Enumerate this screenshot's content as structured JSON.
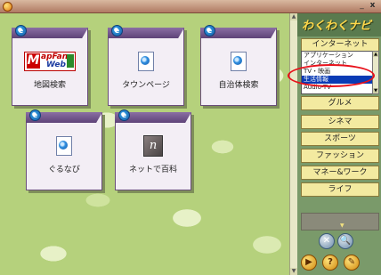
{
  "window": {
    "title": ""
  },
  "tiles": [
    {
      "label": "地図検索",
      "icon": "mapfan-logo-icon"
    },
    {
      "label": "タウンページ",
      "icon": "ie-document-icon"
    },
    {
      "label": "自治体検索",
      "icon": "ie-document-icon"
    },
    {
      "label": "ぐるなび",
      "icon": "ie-document-icon"
    },
    {
      "label": "ネットで百科",
      "icon": "hyakka-icon"
    }
  ],
  "mapfan": {
    "m": "M",
    "top": "apFan",
    "bottom": "Web"
  },
  "hyakka": {
    "glyph": "n"
  },
  "panel": {
    "logo": "わくわくナビ",
    "category_title": "インターネット",
    "dropdown_items": [
      "アプリケーション",
      "インターネット",
      "TV・映画",
      "生活情報",
      "Audio-TV"
    ],
    "dropdown_selected_index": 3,
    "category_buttons": [
      "グルメ",
      "シネマ",
      "スポーツ",
      "ファッション",
      "マネー&ワーク",
      "ライフ"
    ]
  },
  "controls": {
    "min": "_",
    "close": "x",
    "x_button": "✕",
    "search_button": "🔍",
    "play_button": "▶",
    "help_button": "?",
    "edit_button": "✎"
  },
  "colors": {
    "accent_highlight": "#e8101a",
    "selected_item": "#0a3bb5",
    "tile_tab": "#6e5388",
    "background_leaf": "#b5d17c"
  }
}
